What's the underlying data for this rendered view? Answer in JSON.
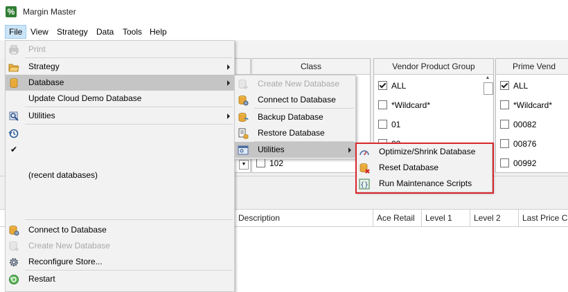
{
  "window": {
    "title": "Margin Master",
    "icon_text": "%"
  },
  "menubar": [
    "File",
    "View",
    "Strategy",
    "Data",
    "Tools",
    "Help"
  ],
  "filters": {
    "class": {
      "header": "Class",
      "items": [
        {
          "label": "102",
          "checked": false
        }
      ]
    },
    "vendor_product_group": {
      "header": "Vendor Product Group",
      "items": [
        {
          "label": "ALL",
          "checked": true
        },
        {
          "label": "*Wildcard*",
          "checked": false
        },
        {
          "label": "01",
          "checked": false
        },
        {
          "label": "03",
          "checked": false
        }
      ]
    },
    "prime_vendor": {
      "header": "Prime Vend",
      "items": [
        {
          "label": "ALL",
          "checked": true
        },
        {
          "label": "*Wildcard*",
          "checked": false
        },
        {
          "label": "00082",
          "checked": false
        },
        {
          "label": "00876",
          "checked": false
        },
        {
          "label": "00992",
          "checked": false
        }
      ]
    }
  },
  "grid": {
    "columns": [
      "Description",
      "Ace Retail",
      "Level 1",
      "Level 2",
      "Last Price Ch"
    ]
  },
  "file_menu": {
    "print": "Print",
    "strategy": "Strategy",
    "database": "Database",
    "update_cloud_demo": "Update Cloud Demo Database",
    "utilities": "Utilities",
    "recent_databases": "(recent databases)",
    "connect_to_database": "Connect to Database",
    "create_new_database": "Create New Database",
    "reconfigure_store": "Reconfigure Store...",
    "restart": "Restart"
  },
  "database_menu": {
    "create_new_database": "Create New Database",
    "connect_to_database": "Connect to Database",
    "backup_database": "Backup Database",
    "restore_database": "Restore Database",
    "utilities": "Utilities"
  },
  "utilities_menu": {
    "optimize": "Optimize/Shrink Database",
    "reset": "Reset Database",
    "run_scripts": "Run Maintenance Scripts"
  },
  "colors": {
    "highlight_border": "#d9262a",
    "menu_bg": "#f2f2f2",
    "menu_hover": "#c5c5c5",
    "app_icon": "#2f7d32"
  }
}
